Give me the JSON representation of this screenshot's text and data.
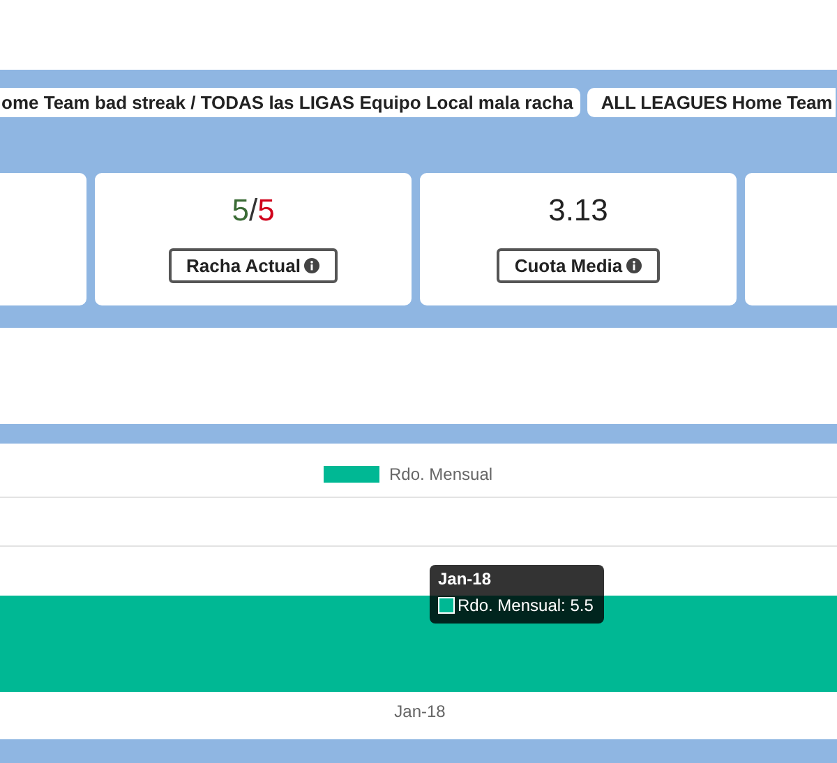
{
  "tabs": [
    {
      "label": "ome Team bad streak / TODAS las LIGAS Equipo Local mala racha"
    },
    {
      "label": "ALL LEAGUES Home Team"
    }
  ],
  "stats": [
    {
      "kind": "empty"
    },
    {
      "kind": "streak",
      "current": "5",
      "separator": "/",
      "total": "5",
      "label": "Racha Actual"
    },
    {
      "kind": "value",
      "value": "3.13",
      "label": "Cuota Media"
    },
    {
      "kind": "empty"
    }
  ],
  "chart": {
    "legend": "Rdo. Mensual",
    "x_label": "Jan-18",
    "tooltip": {
      "title": "Jan-18",
      "text": "Rdo. Mensual: 5.5"
    }
  }
}
